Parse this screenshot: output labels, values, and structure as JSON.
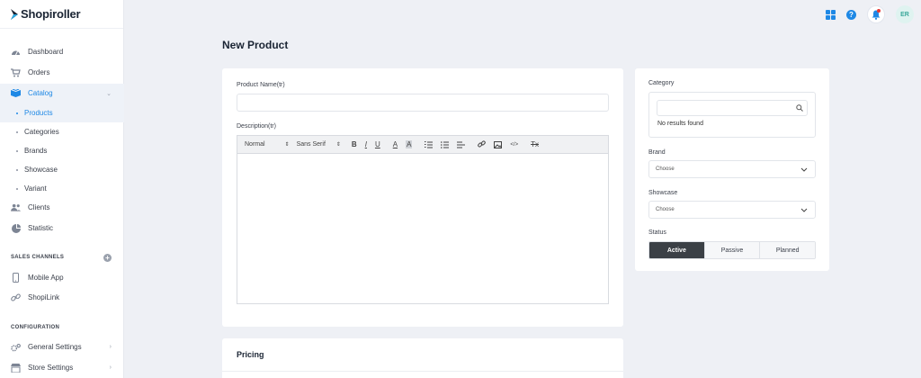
{
  "brand": {
    "name": "Shopiroller"
  },
  "nav": {
    "dashboard": "Dashboard",
    "orders": "Orders",
    "catalog": "Catalog",
    "catalog_sub": [
      "Products",
      "Categories",
      "Brands",
      "Showcase",
      "Variant"
    ],
    "clients": "Clients",
    "statistic": "Statistic",
    "sales_channels_label": "SALES CHANNELS",
    "mobile_app": "Mobile App",
    "shopilink": "ShopiLink",
    "configuration_label": "CONFIGURATION",
    "general_settings": "General Settings",
    "store_settings": "Store Settings"
  },
  "header": {
    "avatar_initials": "ER"
  },
  "page": {
    "title": "New Product"
  },
  "form": {
    "product_name_label": "Product Name(tr)",
    "product_name_value": "",
    "description_label": "Description(tr)",
    "toolbar": {
      "heading_select": "Normal",
      "font_select": "Sans Serif",
      "bold": "B",
      "italic": "I",
      "underline": "U",
      "color": "A",
      "background": "A",
      "clear_format": "Tx"
    },
    "pricing_title": "Pricing"
  },
  "side": {
    "category_label": "Category",
    "category_search_value": "",
    "no_results": "No results found",
    "brand_label": "Brand",
    "brand_value": "Choose",
    "showcase_label": "Showcase",
    "showcase_value": "Choose",
    "status_label": "Status",
    "status_options": [
      "Active",
      "Passive",
      "Planned"
    ],
    "status_selected": "Active"
  },
  "colors": {
    "accent": "#1e88e5",
    "active_status": "#3b4046",
    "notification": "#e53935"
  }
}
